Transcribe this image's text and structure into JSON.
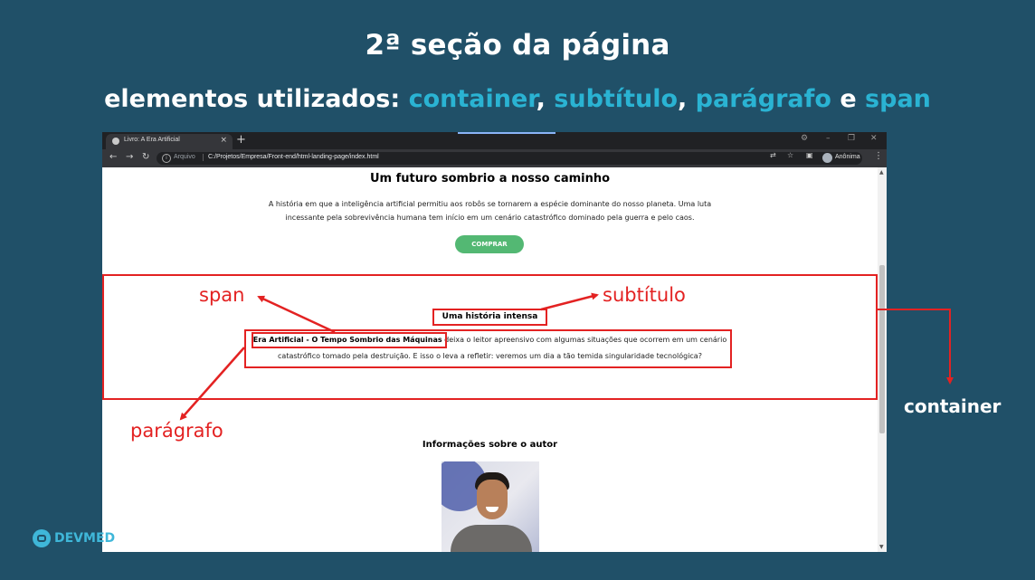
{
  "slide": {
    "title": "2ª seção da página",
    "subtitle_prefix": "elementos utilizados: ",
    "subtitle_parts": {
      "container": "container",
      "comma1": ", ",
      "subtitulo": "subtítulo",
      "comma2": ",  ",
      "paragrafo": "parágrafo",
      "and": " e ",
      "span": "span"
    }
  },
  "browser": {
    "tab_title": "Livro: A Era Artificial",
    "tab_close": "×",
    "new_tab": "+",
    "window_controls": [
      "⚙",
      "–",
      "❐",
      "✕"
    ],
    "nav": {
      "back": "←",
      "forward": "→",
      "reload": "↻"
    },
    "url_scheme": "Arquivo",
    "url_path": "C:/Projetos/Empresa/Front-end/html-landing-page/index.html",
    "toolbar_icons": [
      "translate-icon",
      "star-icon",
      "sidebar-icon"
    ],
    "profile_label": "Anônima",
    "menu": "⋮"
  },
  "page": {
    "h1": "Um futuro sombrio a nosso caminho",
    "intro": "A história em que a inteligência artificial permitiu aos robôs se tornarem a espécie dominante do nosso planeta. Uma luta incessante pela sobrevivência humana tem início em um cenário catastrófico dominado pela guerra e pelo caos.",
    "buy_button": "COMPRAR",
    "section2_title": "Uma história intensa",
    "section2_span": "Era Artificial - O Tempo Sombrio das Máquinas",
    "section2_text": " deixa o leitor apreensivo com algumas situações que ocorrem em um cenário catastrófico tomado pela destruição. E isso o leva a refletir: veremos um dia a tão temida singularidade tecnológica?",
    "author_title": "Informações sobre o autor"
  },
  "annotations": {
    "span": "span",
    "subtitulo": "subtítulo",
    "paragrafo": "parágrafo",
    "container": "container",
    "color": "#e32222"
  },
  "logo": {
    "text": "DEVMED"
  },
  "colors": {
    "background": "#205068",
    "accent": "#2ab3d3",
    "button": "#53b873"
  }
}
